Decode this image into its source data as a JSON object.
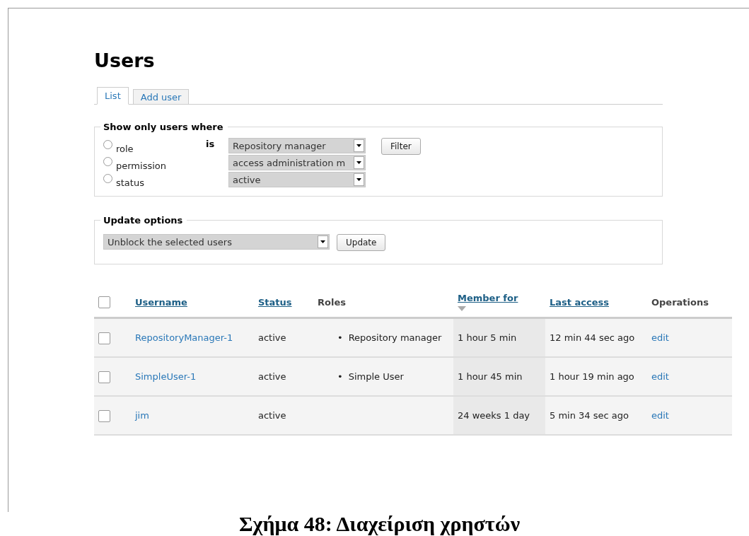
{
  "page": {
    "title": "Users"
  },
  "tabs": [
    {
      "label": "List",
      "selected": true
    },
    {
      "label": "Add user",
      "selected": false
    }
  ],
  "filter": {
    "legend": "Show only users where",
    "operator": "is",
    "button": "Filter",
    "conditions": [
      {
        "label": "role",
        "selected": false,
        "value": "Repository manager"
      },
      {
        "label": "permission",
        "selected": false,
        "value": "access administration m"
      },
      {
        "label": "status",
        "selected": false,
        "value": "active"
      }
    ]
  },
  "update_options": {
    "legend": "Update options",
    "value": "Unblock the selected users",
    "button": "Update"
  },
  "table": {
    "select_all_checked": false,
    "columns": [
      {
        "label": "Username",
        "link": true,
        "sorted": false
      },
      {
        "label": "Status",
        "link": true,
        "sorted": false
      },
      {
        "label": "Roles",
        "link": false,
        "sorted": false
      },
      {
        "label": "Member for",
        "link": true,
        "sorted": true
      },
      {
        "label": "Last access",
        "link": true,
        "sorted": false
      },
      {
        "label": "Operations",
        "link": false,
        "sorted": false
      }
    ],
    "rows": [
      {
        "checked": false,
        "username": "RepositoryManager-1",
        "status": "active",
        "roles": [
          {
            "marker": "•",
            "name": "Repository manager"
          }
        ],
        "member_for": "1 hour 5 min",
        "last_access": "12 min 44 sec ago",
        "operation": "edit"
      },
      {
        "checked": false,
        "username": "SimpleUser-1",
        "status": "active",
        "roles": [
          {
            "marker": "•",
            "name": "Simple User"
          }
        ],
        "member_for": "1 hour 45 min",
        "last_access": "1 hour 19 min ago",
        "operation": "edit"
      },
      {
        "checked": false,
        "username": "jim",
        "status": "active",
        "member_for": "24 weeks 1 day",
        "last_access": "5 min 34 sec ago",
        "operation": "edit"
      }
    ]
  },
  "caption": "Σχήμα 48: Διαχείριση χρηστών"
}
